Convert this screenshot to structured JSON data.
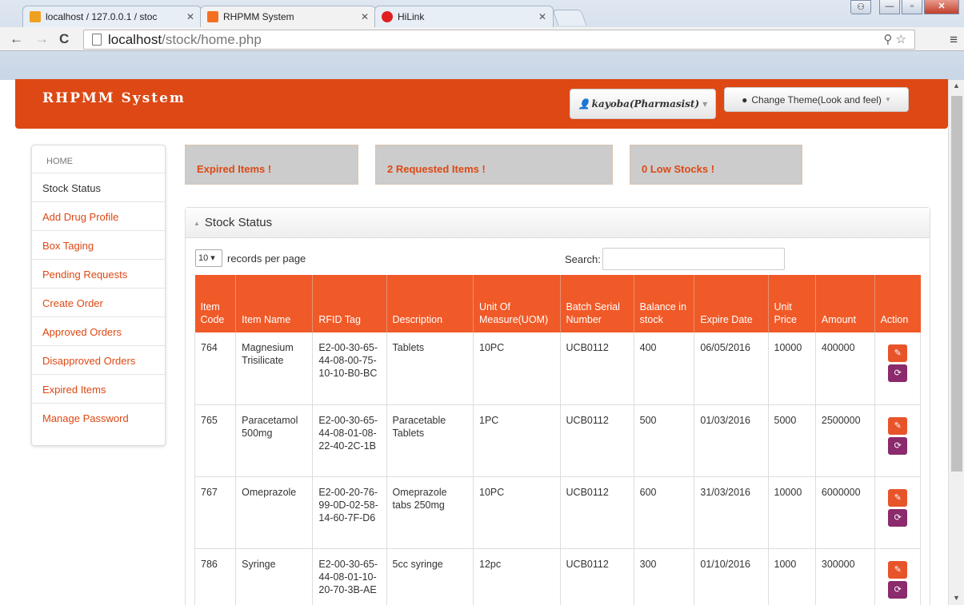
{
  "browser": {
    "tabs": [
      {
        "title": "localhost / 127.0.0.1 / stoc"
      },
      {
        "title": "RHPMM System"
      },
      {
        "title": "HiLink"
      }
    ],
    "url_host": "localhost",
    "url_path": "/stock/home.php"
  },
  "app": {
    "brand": "RHPMM System",
    "user_label": "kayoba(Pharmasist)",
    "theme_label": "Change Theme(Look and feel)"
  },
  "sidebar": {
    "header": "HOME",
    "items": [
      {
        "label": "Stock Status"
      },
      {
        "label": "Add Drug Profile"
      },
      {
        "label": "Box Taging"
      },
      {
        "label": "Pending Requests"
      },
      {
        "label": "Create Order"
      },
      {
        "label": "Approved Orders"
      },
      {
        "label": "Disapproved Orders"
      },
      {
        "label": "Expired Items"
      },
      {
        "label": "Manage Password"
      }
    ]
  },
  "alerts": [
    {
      "label": "Expired Items !"
    },
    {
      "label": "2 Requested Items !"
    },
    {
      "label": "0 Low Stocks !"
    }
  ],
  "panel": {
    "title": "Stock Status",
    "page_length_value": "10",
    "records_label": "records per page",
    "search_label": "Search:",
    "search_value": ""
  },
  "table": {
    "headers": [
      "Item Code",
      "Item Name",
      "RFID Tag",
      "Description",
      "Unit Of Measure(UOM)",
      "Batch Serial Number",
      "Balance in stock",
      "Expire Date",
      "Unit Price",
      "Amount",
      "Action"
    ],
    "rows": [
      {
        "code": "764",
        "name": "Magnesium Trisilicate",
        "rfid": "E2-00-30-65-44-08-00-75-10-10-B0-BC",
        "desc": "Tablets",
        "uom": "10PC",
        "batch": "UCB0112",
        "balance": "400",
        "expire": "06/05/2016",
        "price": "10000",
        "amount": "400000"
      },
      {
        "code": "765",
        "name": "Paracetamol 500mg",
        "rfid": "E2-00-30-65-44-08-01-08-22-40-2C-1B",
        "desc": "Paracetable Tablets",
        "uom": "1PC",
        "batch": "UCB0112",
        "balance": "500",
        "expire": "01/03/2016",
        "price": "5000",
        "amount": "2500000"
      },
      {
        "code": "767",
        "name": "Omeprazole",
        "rfid": "E2-00-20-76-99-0D-02-58-14-60-7F-D6",
        "desc": "Omeprazole tabs 250mg",
        "uom": "10PC",
        "batch": "UCB0112",
        "balance": "600",
        "expire": "31/03/2016",
        "price": "10000",
        "amount": "6000000"
      },
      {
        "code": "786",
        "name": "Syringe",
        "rfid": "E2-00-30-65-44-08-01-10-20-70-3B-AE",
        "desc": "5cc syringe",
        "uom": "12pc",
        "batch": "UCB0112",
        "balance": "300",
        "expire": "01/10/2016",
        "price": "1000",
        "amount": "300000"
      }
    ]
  },
  "colors": {
    "brand_orange": "#dd4814",
    "table_header": "#f05a28",
    "edit_button": "#e8542a",
    "swap_button": "#8b2a6c"
  }
}
